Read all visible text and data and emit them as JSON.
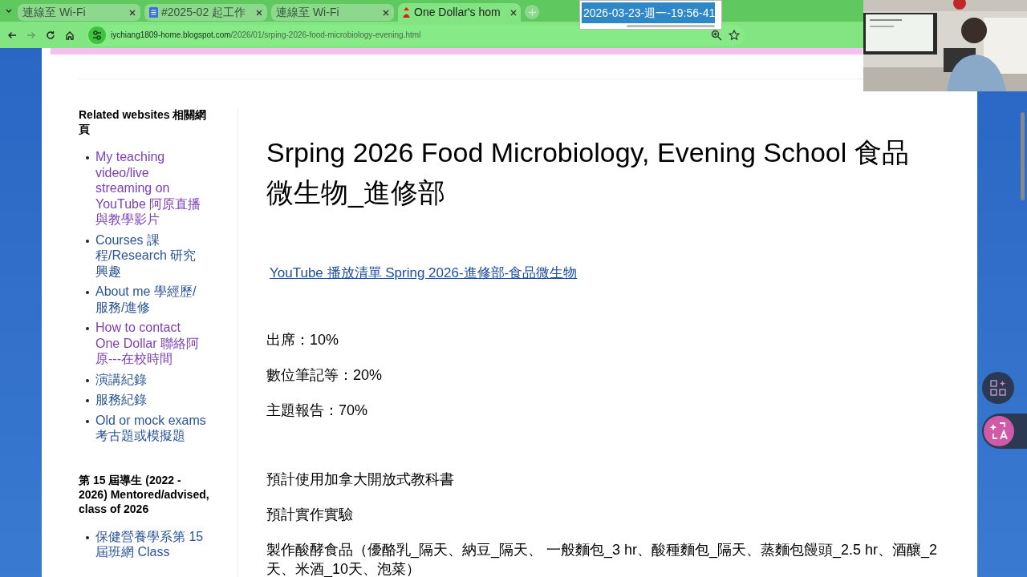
{
  "tab_strip": {
    "tabs": [
      {
        "title": "連線至 Wi-Fi",
        "kind": "plain",
        "selected": false
      },
      {
        "title": "#2025-02 起工作",
        "kind": "document",
        "selected": false
      },
      {
        "title": "連線至 Wi-Fi",
        "kind": "plain",
        "selected": false
      },
      {
        "title": "One Dollar's hom",
        "kind": "site",
        "selected": true
      }
    ]
  },
  "toolbar": {
    "nav_buttons": [
      {
        "kind": "back",
        "disabled": false
      },
      {
        "kind": "forward",
        "disabled": true
      },
      {
        "kind": "reload",
        "disabled": false
      },
      {
        "kind": "home",
        "disabled": false
      }
    ],
    "url_domain": "iychiang1809-home.blogspot.com",
    "url_path": "/2026/01/srping-2026-food-microbiology-evening.html"
  },
  "clock_popup": {
    "text": "2026-03-23-週一-19:56-41"
  },
  "sidebar": {
    "sections": [
      {
        "heading": "Related websites 相關網頁",
        "links": [
          {
            "text": "My teaching video/live streaming on YouTube 阿原直播與教學影片",
            "visited": true
          },
          {
            "text": "Courses 課程/Research 研究興趣",
            "visited": false
          },
          {
            "text": "About me 學經歷/服務/進修",
            "visited": false
          },
          {
            "text": "How to contact One Dollar 聯絡阿原---在校時間",
            "visited": true
          },
          {
            "text": "演講紀錄",
            "visited": false
          },
          {
            "text": "服務紀錄",
            "visited": false
          },
          {
            "text": "Old or mock exams 考古題或模擬題",
            "visited": false
          }
        ]
      },
      {
        "heading": "第 15 屆導生 (2022 - 2026) Mentored/advised, class of 2026",
        "links": [
          {
            "text": "保健營養學系第 15 屆班網 Class",
            "visited": false
          }
        ]
      }
    ]
  },
  "article": {
    "title": "Srping 2026 Food Microbiology, Evening School 食品微生物_進修部",
    "link": "YouTube 播放清單 Spring 2026-進修部-食品微生物",
    "paragraph_groups": [
      [
        "出席：10%",
        "數位筆記等：20%",
        "主題報告：70%"
      ],
      [
        "預計使用加拿大開放式教科書",
        "預計實作實驗",
        "製作酸酵食品（優酪乳_隔天、納豆_隔天、 一般麵包_3 hr、酸種麵包_隔天、蒸麵包饅頭_2.5 hr、酒釀_2天、米酒_10天、泡菜）"
      ]
    ]
  }
}
